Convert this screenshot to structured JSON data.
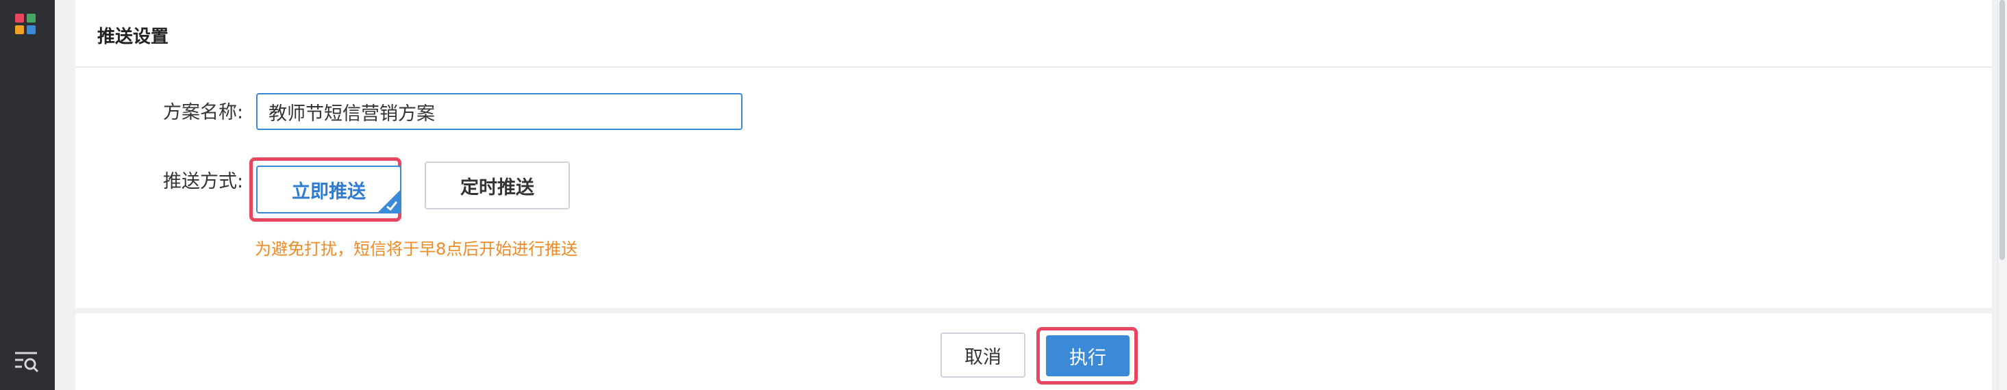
{
  "sidebar": {
    "top_icon": "apps-grid-icon",
    "bottom_icon": "search-list-icon",
    "apps_icon_colors": [
      "#e8455e",
      "#4aa564",
      "#f0a024",
      "#3a8ad8"
    ]
  },
  "panel": {
    "title": "推送设置"
  },
  "form": {
    "name_label": "方案名称:",
    "name_value": "教师节短信营销方案",
    "method_label": "推送方式:",
    "method_options": {
      "immediate": "立即推送",
      "scheduled": "定时推送"
    },
    "selected_method": "立即推送",
    "hint": "为避免打扰，短信将于早8点后开始进行推送"
  },
  "footer": {
    "cancel_label": "取消",
    "execute_label": "执行"
  },
  "colors": {
    "accent": "#3a8ad8",
    "highlight": "#e8455e",
    "hint": "#f08a24",
    "sidebar": "#2d2f33"
  }
}
